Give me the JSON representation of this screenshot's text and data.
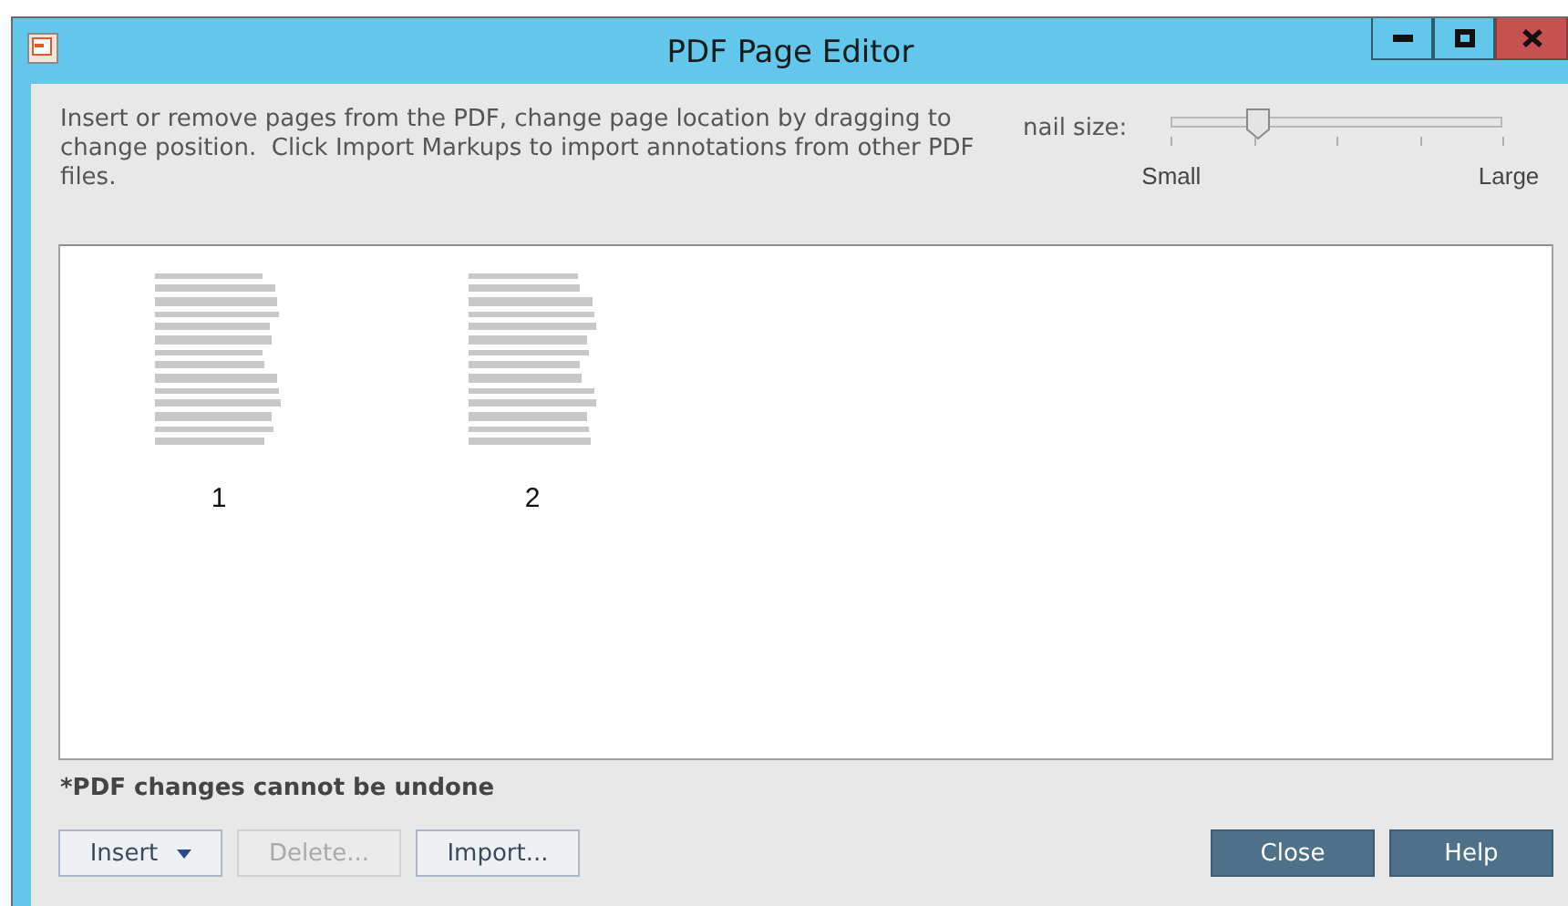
{
  "window": {
    "title": "PDF Page Editor"
  },
  "description": "Insert or remove pages from the PDF, change page location by dragging to change position.  Click Import Markups to import annotations from other PDF files.",
  "thumbnail_size": {
    "label": "nail size:",
    "level": 0.26,
    "min_label": "Small",
    "max_label": "Large"
  },
  "pages": [
    {
      "number": "1",
      "kind": "picture"
    },
    {
      "number": "2",
      "kind": "picture"
    }
  ],
  "note": "*PDF changes cannot be undone",
  "buttons": [
    {
      "label": "Insert",
      "kind": "dropdown",
      "disabled": false
    },
    {
      "label": "Delete...",
      "kind": "plain",
      "disabled": true
    },
    {
      "label": "Import...",
      "kind": "plain",
      "disabled": false
    },
    {
      "label": "Close",
      "kind": "primary",
      "disabled": false
    },
    {
      "label": "Help",
      "kind": "primary",
      "disabled": false
    }
  ]
}
